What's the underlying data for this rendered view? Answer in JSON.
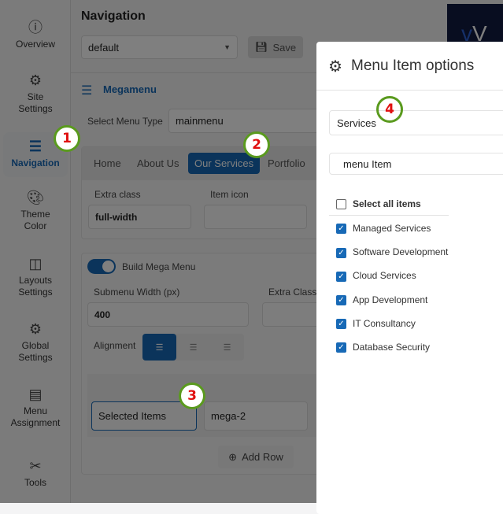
{
  "sidebar": {
    "items": [
      {
        "label": "Overview",
        "icon": "info-icon"
      },
      {
        "label": "Site Settings",
        "icon": "gear-icon"
      },
      {
        "label": "Navigation",
        "icon": "menu-icon"
      },
      {
        "label": "Theme Color",
        "icon": "palette-icon"
      },
      {
        "label": "Layouts Settings",
        "icon": "layout-icon"
      },
      {
        "label": "Global Settings",
        "icon": "gears-icon"
      },
      {
        "label": "Menu Assignment",
        "icon": "list-icon"
      },
      {
        "label": "Tools",
        "icon": "tools-icon"
      }
    ]
  },
  "header": {
    "title": "Navigation",
    "preset": "default",
    "save_label": "Save"
  },
  "megamenu": {
    "title": "Megamenu",
    "menu_type_label": "Select Menu Type",
    "menu_type_value": "mainmenu",
    "tabs": [
      "Home",
      "About Us",
      "Our Services",
      "Portfolio"
    ],
    "extra_class_label": "Extra class",
    "extra_class_value": "full-width",
    "item_icon_label": "Item icon",
    "build_label": "Build Mega Menu",
    "submenu_width_label": "Submenu Width (px)",
    "submenu_width_value": "400",
    "extra_class2_label": "Extra Class",
    "alignment_label": "Alignment",
    "selected_items": "Selected Items",
    "row_class": "mega-2",
    "add_row": "Add Row"
  },
  "modal": {
    "title": "Menu Item options",
    "title_input": "Services",
    "type_select": "menu Item",
    "select_all": "Select all items",
    "items": [
      "Managed Services",
      "Software Development",
      "Cloud Services",
      "App Development",
      "IT Consultancy",
      "Database Security"
    ]
  },
  "callouts": [
    "1",
    "2",
    "3",
    "4"
  ],
  "colors": {
    "accent": "#1769b6",
    "callout_border": "#5a9a1e",
    "callout_text": "#e01010"
  }
}
